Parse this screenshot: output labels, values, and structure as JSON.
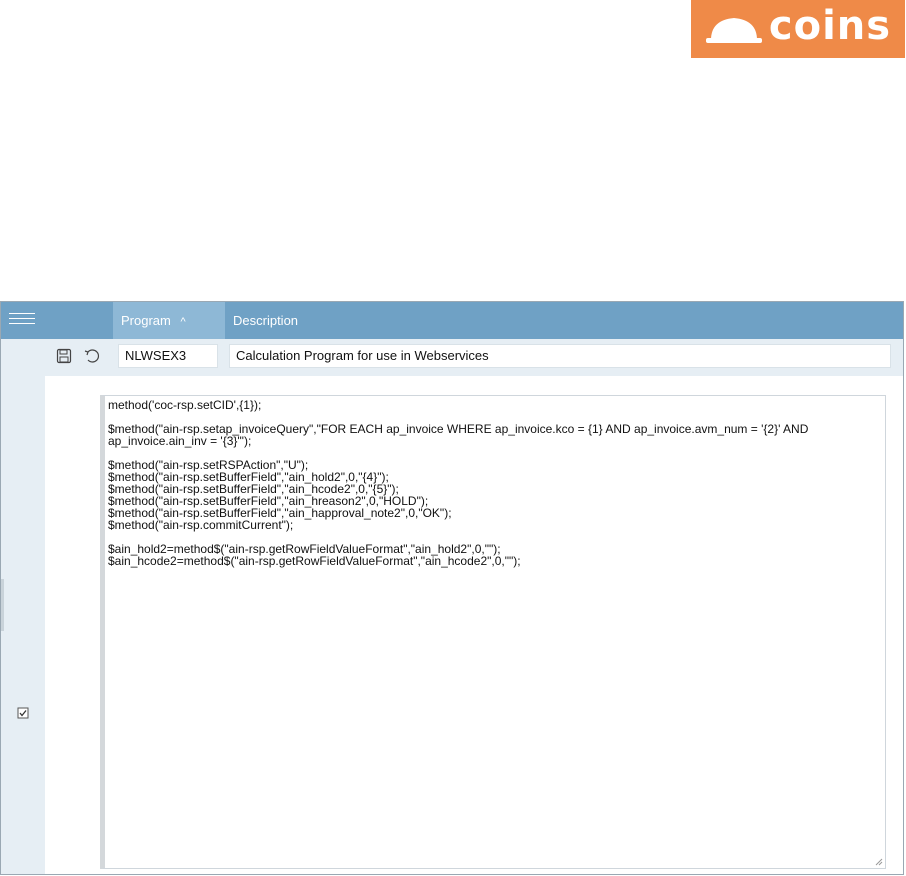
{
  "brand": {
    "name": "coins",
    "color": "#ef8a48"
  },
  "toolbar": {
    "menu_icon": "hamburger-menu-icon"
  },
  "grid": {
    "columns": [
      {
        "label": "Program",
        "sort": "^"
      },
      {
        "label": "Description"
      }
    ],
    "row": {
      "save_icon": "save-icon",
      "undo_icon": "undo-icon",
      "program": "NLWSEX3",
      "description": "Calculation Program for use in Webservices"
    }
  },
  "checkbox_icon": "checkbox-icon",
  "editor": {
    "code": "method('coc-rsp.setCID',{1});\n\n$method(\"ain-rsp.setap_invoiceQuery\",\"FOR EACH ap_invoice WHERE ap_invoice.kco = {1} AND ap_invoice.avm_num = '{2}' AND ap_invoice.ain_inv = '{3}'\");\n\n$method(\"ain-rsp.setRSPAction\",\"U\");\n$method(\"ain-rsp.setBufferField\",\"ain_hold2\",0,\"{4}\");\n$method(\"ain-rsp.setBufferField\",\"ain_hcode2\",0,\"{5}\");\n$method(\"ain-rsp.setBufferField\",\"ain_hreason2\",0,\"HOLD\");\n$method(\"ain-rsp.setBufferField\",\"ain_happroval_note2\",0,\"OK\");\n$method(\"ain-rsp.commitCurrent\");\n\n$ain_hold2=method$(\"ain-rsp.getRowFieldValueFormat\",\"ain_hold2\",0,\"\");\n$ain_hcode2=method$(\"ain-rsp.getRowFieldValueFormat\",\"ain_hcode2\",0,\"\");"
  }
}
